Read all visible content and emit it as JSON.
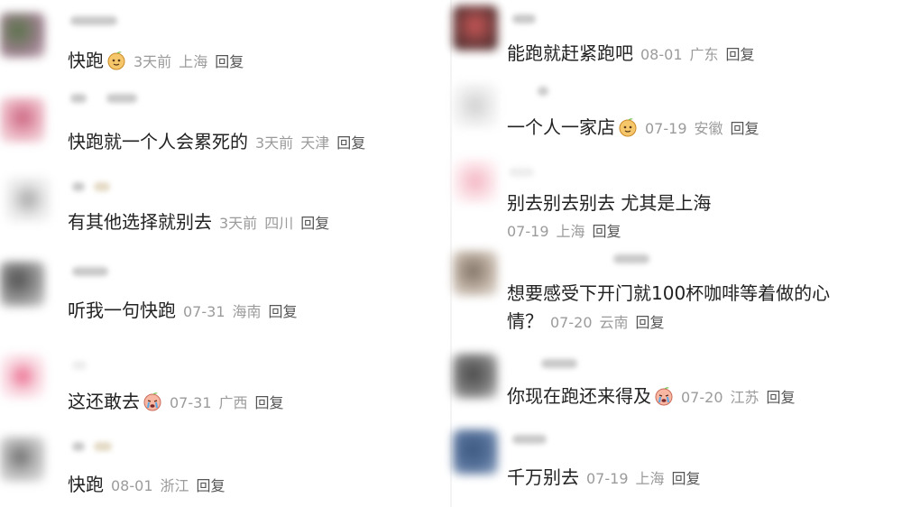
{
  "colors": {
    "text": "#222222",
    "meta": "#9b9b9b",
    "reply": "#555555",
    "emoji_face": "#f5c66a",
    "emoji_leaf": "#6fbf4a"
  },
  "comments_left": [
    {
      "text": "快跑",
      "emoji": "melon-face-emoji",
      "time": "3天前",
      "location": "上海",
      "reply": "回复"
    },
    {
      "text": "快跑就一个人会累死的",
      "time": "3天前",
      "location": "天津",
      "reply": "回复"
    },
    {
      "text": "有其他选择就别去",
      "time": "3天前",
      "location": "四川",
      "reply": "回复"
    },
    {
      "text": "听我一句快跑",
      "time": "07-31",
      "location": "海南",
      "reply": "回复"
    },
    {
      "text": "这还敢去",
      "emoji": "crying-face-emoji",
      "time": "07-31",
      "location": "广西",
      "reply": "回复"
    },
    {
      "text": "快跑",
      "time": "08-01",
      "location": "浙江",
      "reply": "回复"
    }
  ],
  "comments_right": [
    {
      "text": "能跑就赶紧跑吧",
      "time": "08-01",
      "location": "广东",
      "reply": "回复"
    },
    {
      "text": "一个人一家店",
      "emoji": "melon-face-emoji",
      "time": "07-19",
      "location": "安徽",
      "reply": "回复"
    },
    {
      "text": "别去别去别去 尤其是上海",
      "time": "07-19",
      "location": "上海",
      "reply": "回复"
    },
    {
      "text": "想要感受下开门就100杯咖啡等着做的心",
      "text2": "情？",
      "time": "07-20",
      "location": "云南",
      "reply": "回复"
    },
    {
      "text": "你现在跑还来得及",
      "emoji": "crying-face-emoji",
      "time": "07-20",
      "location": "江苏",
      "reply": "回复"
    },
    {
      "text": "千万别去",
      "time": "07-19",
      "location": "上海",
      "reply": "回复"
    }
  ]
}
